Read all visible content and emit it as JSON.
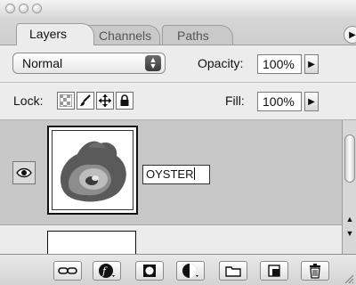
{
  "tabs": [
    {
      "label": "Layers",
      "active": true
    },
    {
      "label": "Channels",
      "active": false
    },
    {
      "label": "Paths",
      "active": false
    }
  ],
  "blend": {
    "mode": "Normal"
  },
  "opacity": {
    "label": "Opacity:",
    "value": "100%"
  },
  "lock": {
    "label": "Lock:"
  },
  "fill": {
    "label": "Fill:",
    "value": "100%"
  },
  "layers": [
    {
      "name": "OYSTER",
      "visible": true,
      "selected": true,
      "editing": true
    },
    {
      "name": "",
      "visible": false,
      "selected": false,
      "editing": false
    }
  ],
  "icons": {
    "link": "link-icon",
    "layer_style": "layer-style-icon",
    "mask": "add-mask-icon",
    "adjustment": "adjustment-layer-icon",
    "group": "folder-icon",
    "new_layer": "new-layer-icon",
    "delete": "trash-icon"
  },
  "colors": {
    "selected_row": "#c8c8c8",
    "panel": "#e8e8e8"
  }
}
